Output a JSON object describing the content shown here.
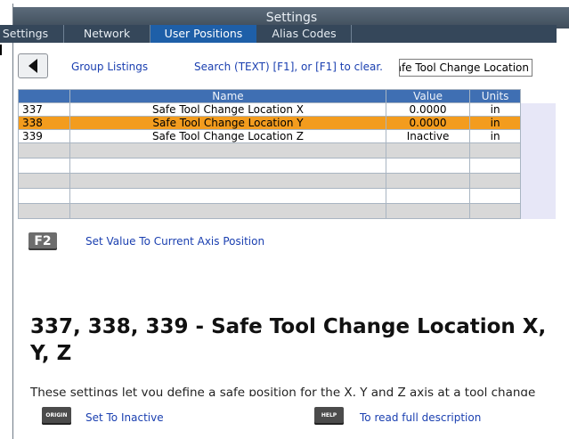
{
  "window": {
    "title": "Settings"
  },
  "tabs": [
    "Settings",
    "Network",
    "User Positions",
    "Alias Codes"
  ],
  "toolbar": {
    "group_listings": "Group Listings",
    "search_hint": "Search (TEXT) [F1], or [F1] to clear.",
    "search_value": "Safe Tool Change Location"
  },
  "table": {
    "headers": [
      "",
      "Name",
      "Value",
      "Units"
    ],
    "rows": [
      {
        "num": "337",
        "name": "Safe Tool Change Location X",
        "value": "0.0000",
        "units": "in"
      },
      {
        "num": "338",
        "name": "Safe Tool Change Location Y",
        "value": "0.0000",
        "units": "in"
      },
      {
        "num": "339",
        "name": "Safe Tool Change Location Z",
        "value": "Inactive",
        "units": "in"
      }
    ]
  },
  "actions": {
    "f2_key": "F2",
    "f2_label": "Set Value To Current Axis Position",
    "origin_key": "ORIGIN",
    "origin_label": "Set To Inactive",
    "help_key": "HELP",
    "help_label": "To read full description"
  },
  "detail": {
    "heading": "337, 338, 339 - Safe Tool Change Location X, Y, Z",
    "description": "These settings let you define a safe position for the X, Y and Z axis at a tool change"
  },
  "colors": {
    "selected_row": "#f39c1e",
    "header": "#3f6fb3",
    "active_tab": "#1e5fa8"
  }
}
